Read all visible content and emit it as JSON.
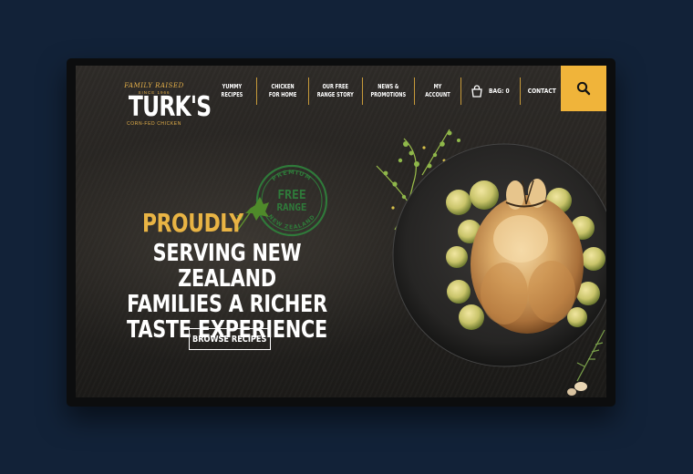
{
  "logo": {
    "tagline": "FAMILY RAISED",
    "since": "SINCE 1966",
    "brand": "TURK'S",
    "subline": "CORN-FED CHICKEN"
  },
  "nav": {
    "items": [
      {
        "line1": "YUMMY",
        "line2": "RECIPES"
      },
      {
        "line1": "CHICKEN",
        "line2": "FOR HOME"
      },
      {
        "line1": "OUR FREE",
        "line2": "RANGE STORY"
      },
      {
        "line1": "NEWS &",
        "line2": "PROMOTIONS"
      },
      {
        "line1": "MY",
        "line2": "ACCOUNT"
      }
    ],
    "bag_label": "BAG: 0",
    "contact_label": "CONTACT",
    "search_icon": "search-icon",
    "bag_icon": "shopping-bag-icon"
  },
  "stamp": {
    "top": "PREMIUM",
    "line1": "FREE",
    "line2": "RANGE",
    "bottom": "NEW ZEALAND"
  },
  "hero": {
    "proudly": "PROUDLY",
    "line1": "SERVING NEW ZEALAND",
    "line2": "FAMILIES A RICHER",
    "line3": "TASTE EXPERIENCE",
    "cta": "BROWSE RECIPES"
  },
  "colors": {
    "accent": "#f0b43a",
    "page_bg": "#122238",
    "stamp_green": "#2f7a3a"
  }
}
